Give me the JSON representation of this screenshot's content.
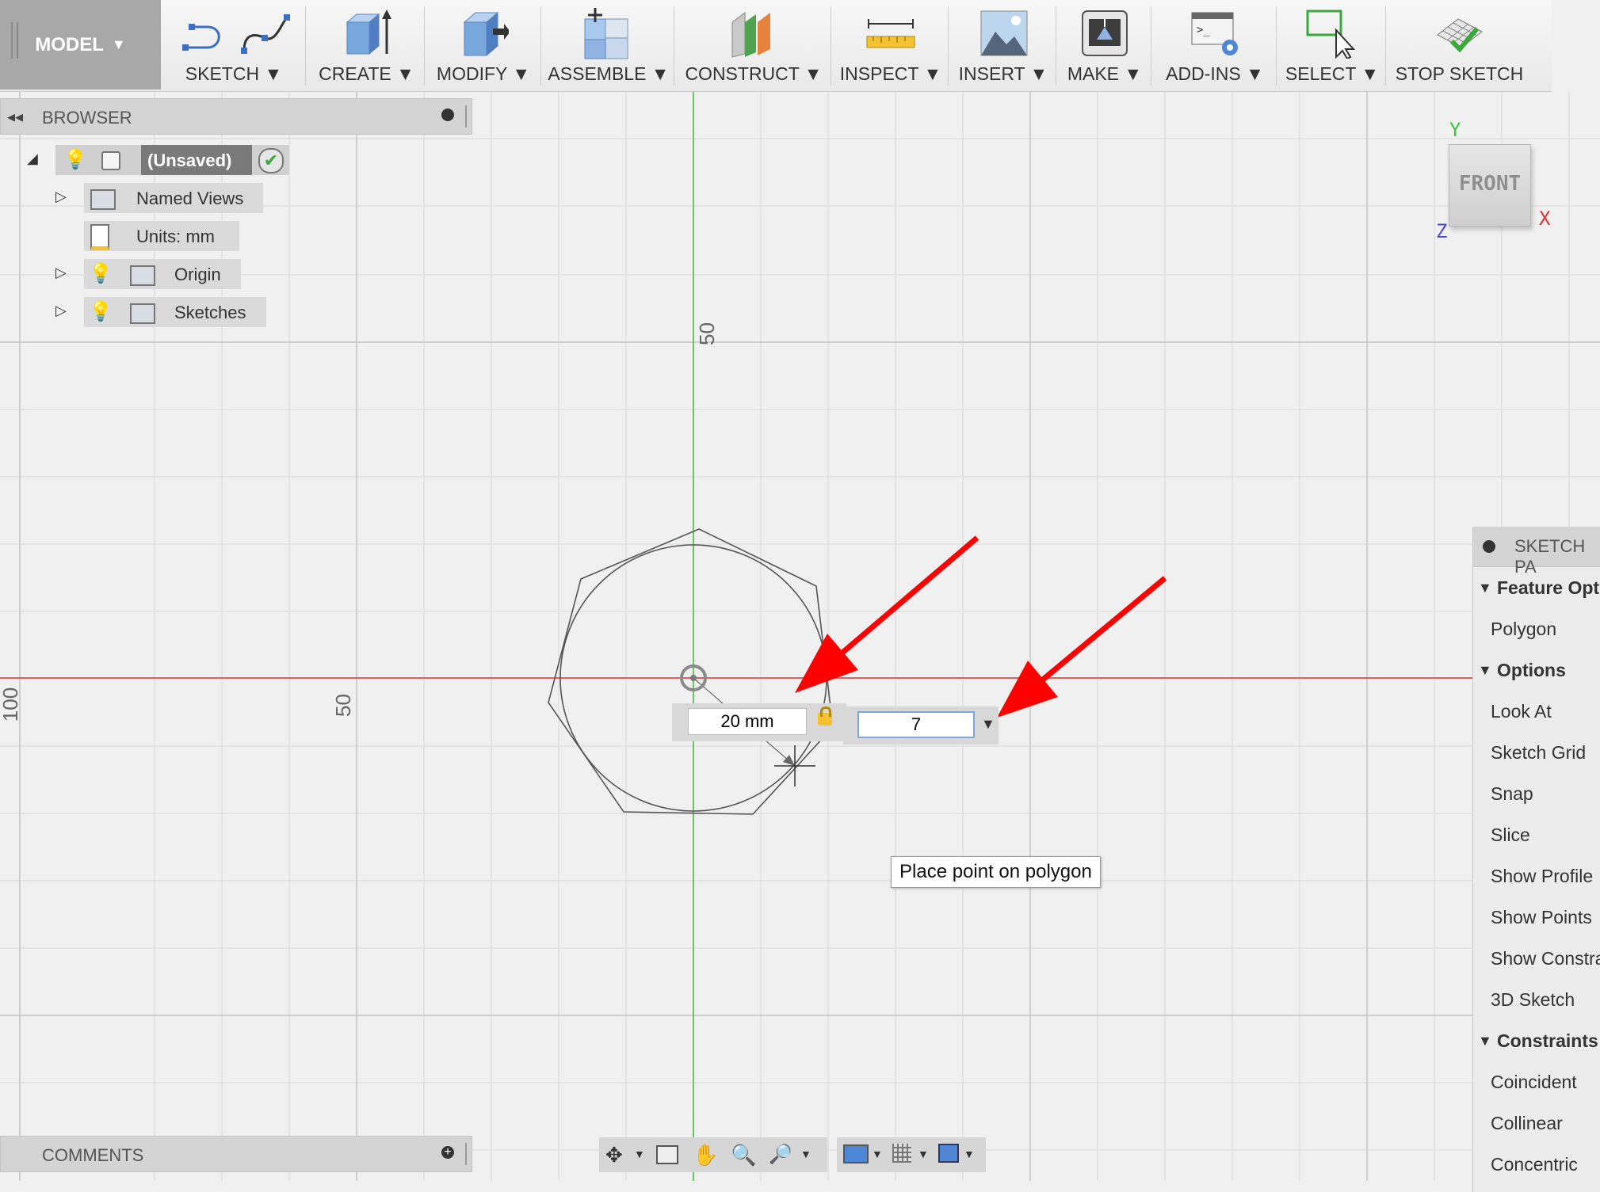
{
  "toolbar": {
    "workspace": "MODEL",
    "groups": [
      {
        "label": "SKETCH",
        "icon": "sketch-line-spline-icon"
      },
      {
        "label": "CREATE",
        "icon": "extrude-box-icon"
      },
      {
        "label": "MODIFY",
        "icon": "press-pull-icon"
      },
      {
        "label": "ASSEMBLE",
        "icon": "new-component-icon"
      },
      {
        "label": "CONSTRUCT",
        "icon": "construction-plane-icon"
      },
      {
        "label": "INSPECT",
        "icon": "measure-ruler-icon"
      },
      {
        "label": "INSERT",
        "icon": "insert-image-icon"
      },
      {
        "label": "MAKE",
        "icon": "3d-print-icon"
      },
      {
        "label": "ADD-INS",
        "icon": "scripts-addins-icon"
      },
      {
        "label": "SELECT",
        "icon": "select-cursor-icon"
      },
      {
        "label": "STOP SKETCH",
        "icon": "stop-sketch-check-icon"
      }
    ]
  },
  "browser": {
    "title": "BROWSER",
    "root": {
      "label": "(Unsaved)"
    },
    "items": [
      {
        "label": "Named Views"
      },
      {
        "label": "Units: mm"
      },
      {
        "label": "Origin"
      },
      {
        "label": "Sketches"
      }
    ]
  },
  "canvas": {
    "axis_labels": {
      "top": "50",
      "left": "50",
      "edge": "100"
    }
  },
  "viewcube": {
    "face": "FRONT",
    "x": "X",
    "y": "Y",
    "z": "Z"
  },
  "polygon_input": {
    "dimension_value": "20 mm",
    "sides_value": "7",
    "tooltip": "Place point on polygon"
  },
  "sketch_palette": {
    "title": "SKETCH PA",
    "rows": [
      {
        "type": "section",
        "label": "Feature Opt"
      },
      {
        "type": "option",
        "label": "Polygon"
      },
      {
        "type": "section",
        "label": "Options"
      },
      {
        "type": "option",
        "label": "Look At"
      },
      {
        "type": "option",
        "label": "Sketch Grid"
      },
      {
        "type": "option",
        "label": "Snap"
      },
      {
        "type": "option",
        "label": "Slice"
      },
      {
        "type": "option",
        "label": "Show Profile"
      },
      {
        "type": "option",
        "label": "Show Points"
      },
      {
        "type": "option",
        "label": "Show Constra"
      },
      {
        "type": "option",
        "label": "3D Sketch"
      },
      {
        "type": "section",
        "label": "Constraints"
      },
      {
        "type": "option",
        "label": "Coincident"
      },
      {
        "type": "option",
        "label": "Collinear"
      },
      {
        "type": "option",
        "label": "Concentric"
      }
    ]
  },
  "comments": {
    "title": "COMMENTS"
  },
  "colors": {
    "x_axis": "#e03030",
    "y_axis": "#3cc43c",
    "annotation_arrow": "#ff0000",
    "selection_blue": "#7ea7dc"
  }
}
